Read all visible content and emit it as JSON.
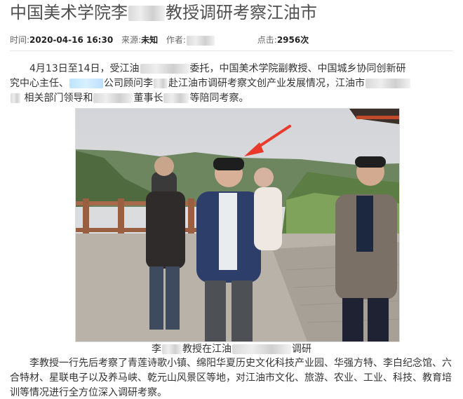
{
  "article": {
    "title_part1": "中国美术学院李",
    "title_part2": "教授调研考察江油市",
    "meta": {
      "time_label": "时间:",
      "time_value": "2020-04-16 16:30",
      "source_label": "来源:",
      "source_value": "未知",
      "author_label": "作者:",
      "views_label": "点击:",
      "views_value": "2956次"
    },
    "para1": {
      "l1a": "4月13日至14日，受江油",
      "l1b": "委托，中国美术学院副教授、中国城乡协同创新研",
      "l2a": "究中心主任、",
      "l2b": "公司顾问李",
      "l2c": "赴江油市调研考察文创产业发展情况，江油市",
      "l3a": "相关部门领导和",
      "l3b": "董事长",
      "l3c": "等陪同考察。"
    },
    "caption_a": "李",
    "caption_b": "教授在江油",
    "caption_c": "调研",
    "para2": {
      "l1": "李教授一行先后考察了青莲诗歌小镇、绵阳华夏历史文化科技产业园、华强方特、李白纪念馆、六",
      "l2": "合特材、星联电子以及养马峡、乾元山风景区等地，对江油市文化、旅游、农业、工业、科技、教育培",
      "l3": "训等情况进行全方位深入调研考察。"
    }
  },
  "colors": {
    "title": "#505050",
    "arrow": "#e8392a",
    "sky": "#d6d9dc",
    "hills": "#5f7a4c"
  }
}
